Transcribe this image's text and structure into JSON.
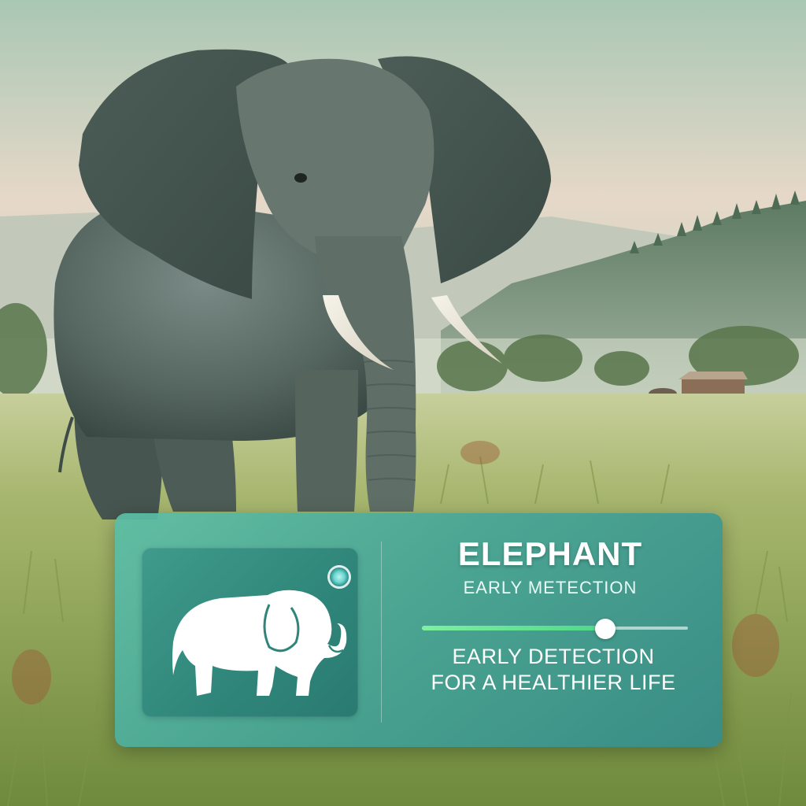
{
  "card": {
    "title": "ELEPHANT",
    "subtitle": "EARLY METECTION",
    "tagline_line1": "EARLY DETECTION",
    "tagline_line2": "FOR A HEALTHIER LIFE",
    "icon": "elephant-icon",
    "status_icon": "status-dot-icon",
    "slider_level": 0.69
  },
  "colors": {
    "card_accent": "#4fa896",
    "slider_fill": "#5fe08f",
    "text": "#ffffff"
  }
}
